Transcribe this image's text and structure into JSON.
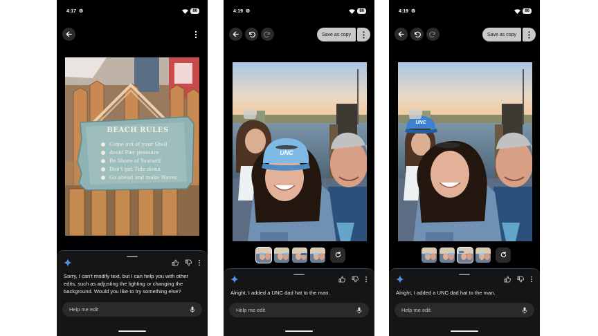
{
  "screens": [
    {
      "status_time": "4:17",
      "battery": "86",
      "message": "Sorry, I can't modify text, but I can help you with other edits, such as adjusting the lighting or changing the background. Would you like to try something else?",
      "input_placeholder": "Help me edit",
      "sign": {
        "title": "BEACH RULES",
        "lines": [
          "Come out of your Shell",
          "Avoid Pier pressure",
          "Be Shore of Yourself",
          "Don't get Tide down",
          "Go ahead and make Waves"
        ]
      }
    },
    {
      "status_time": "4:19",
      "battery": "86",
      "save_label": "Save as copy",
      "message": "Alright, I added a UNC dad hat to the man.",
      "input_placeholder": "Help me edit",
      "hat_text": "UNC"
    },
    {
      "status_time": "4:19",
      "battery": "86",
      "save_label": "Save as copy",
      "message": "Alright, I added a UNC dad hat to the man.",
      "input_placeholder": "Help me edit",
      "hat_text": "UNC"
    }
  ],
  "icons": {
    "back": "arrow-left-icon",
    "undo": "undo-icon",
    "redo": "redo-icon",
    "more": "more-vertical-icon",
    "gemini": "sparkle-icon",
    "thumbs_up": "thumbs-up-icon",
    "thumbs_down": "thumbs-down-icon",
    "mic": "mic-icon",
    "regenerate": "refresh-icon",
    "alarm": "alarm-icon",
    "wifi": "wifi-icon"
  },
  "colors": {
    "accent": "#4a90ff",
    "background": "#000000",
    "sheet": "#151515"
  }
}
